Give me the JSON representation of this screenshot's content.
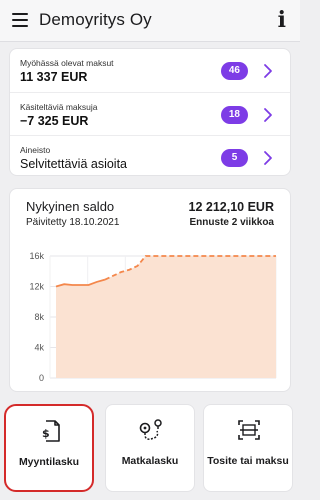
{
  "header": {
    "title": "Demoyritys Oy",
    "menu_icon": "hamburger-menu-icon",
    "info_icon": "info-icon",
    "info_glyph": "i"
  },
  "summary": {
    "rows": [
      {
        "label": "Myöhässä olevat maksut",
        "value": "11 337 EUR",
        "count": "46"
      },
      {
        "label": "Käsiteltäviä maksuja",
        "value": "−7 325 EUR",
        "count": "18"
      },
      {
        "label": "Aineisto",
        "value": "Selvitettäviä asioita",
        "count": "5"
      }
    ],
    "badge_color": "#7d3ce6"
  },
  "balance": {
    "label": "Nykyinen saldo",
    "updated": "Päivitetty 18.10.2021",
    "amount": "12 212,10 EUR",
    "forecast": "Ennuste 2 viikkoa"
  },
  "chart_data": {
    "type": "area",
    "title": "",
    "xlabel": "",
    "ylabel": "",
    "yticks": [
      "16k",
      "12k",
      "8k",
      "4k",
      "0"
    ],
    "ylim": [
      0,
      16000
    ],
    "grid": true,
    "series": [
      {
        "style": "solid",
        "color": "#f4874b",
        "values": [
          12000,
          12300,
          12200,
          12200,
          12200,
          12600,
          12900
        ]
      },
      {
        "style": "dashed",
        "color": "#f4874b",
        "values": [
          12900,
          13400,
          13900,
          14200,
          14700,
          16000,
          16000,
          16000,
          16000,
          16000,
          16000,
          16000,
          16000,
          16000,
          16000,
          16000,
          16000,
          16000,
          16000,
          16000,
          16000,
          16000
        ]
      }
    ]
  },
  "actions": [
    {
      "label": "Myyntilasku",
      "icon": "invoice-dollar-icon",
      "highlighted": true
    },
    {
      "label": "Matkalasku",
      "icon": "route-pin-icon",
      "highlighted": false
    },
    {
      "label": "Tosite tai maksu",
      "icon": "scan-document-icon",
      "highlighted": false
    }
  ],
  "colors": {
    "accent": "#7d3ce6",
    "chart_line": "#f4874b",
    "chart_fill": "#fbe2d2",
    "highlight_border": "#d42a2a"
  }
}
